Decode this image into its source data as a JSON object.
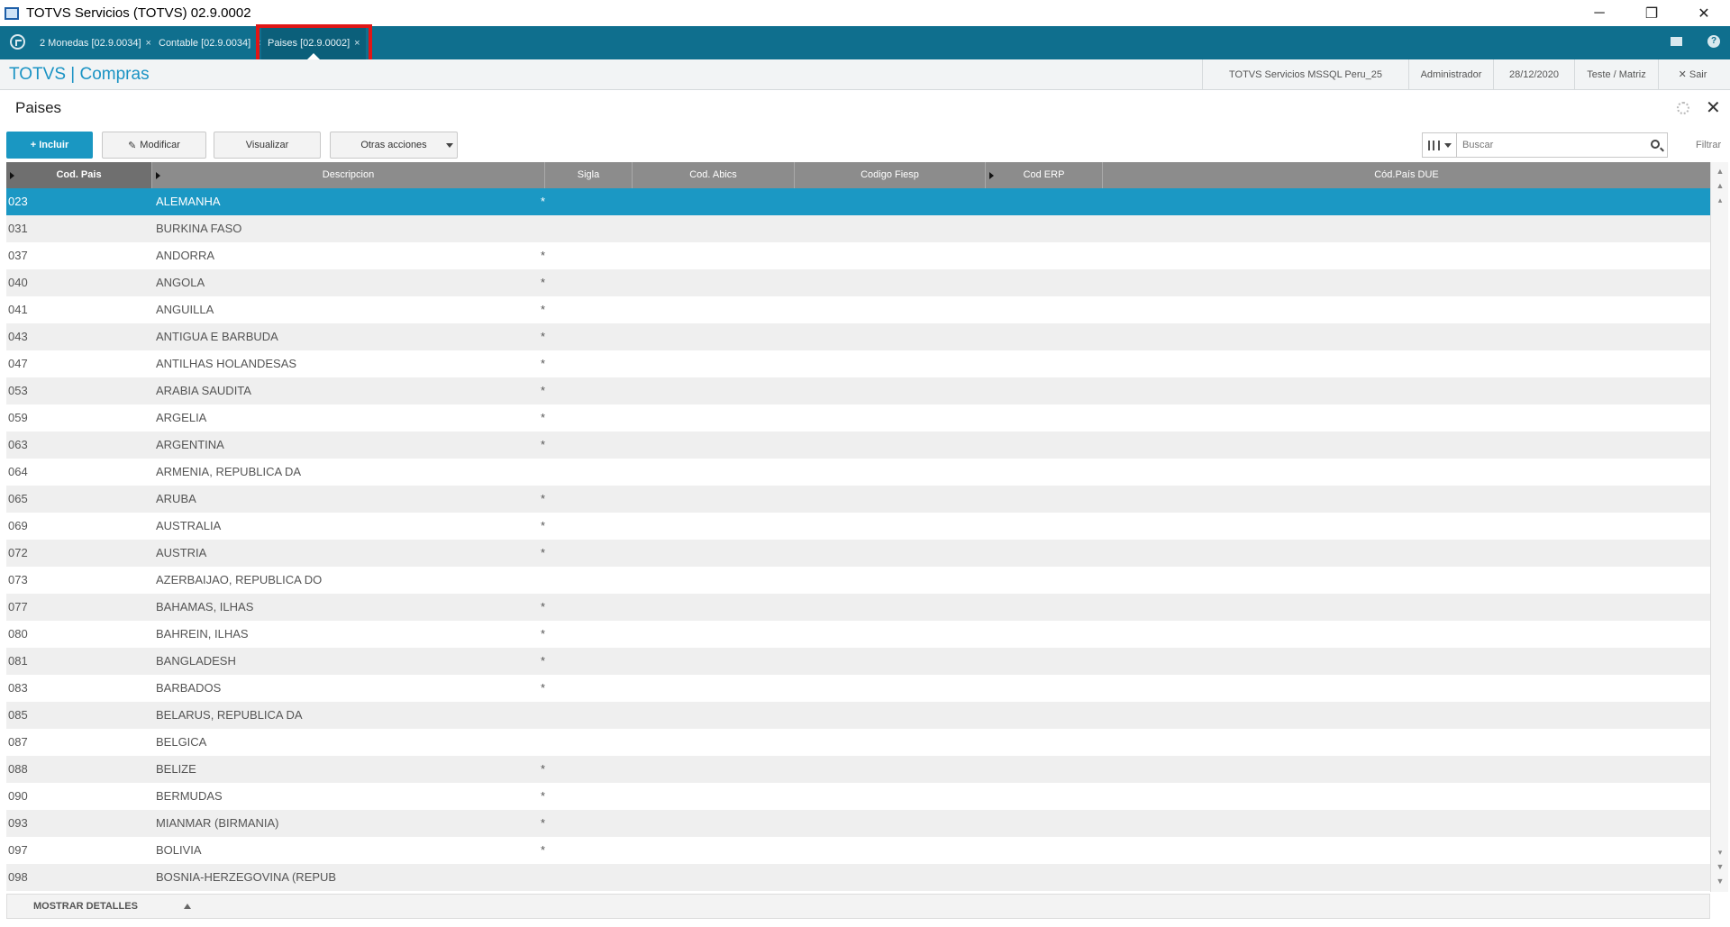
{
  "window": {
    "title": "TOTVS Servicios (TOTVS) 02.9.0002",
    "minimize": "─",
    "maximize": "❐",
    "close": "✕"
  },
  "tabs": [
    {
      "label": "2 Monedas [02.9.0034]",
      "close": "×"
    },
    {
      "label": "Contable [02.9.0034]",
      "close": "×"
    },
    {
      "label": "Paises [02.9.0002]",
      "close": "×"
    }
  ],
  "icons": {
    "home": "home-icon",
    "mail": "mail-icon",
    "help": "?"
  },
  "header": {
    "brand": "TOTVS | Compras",
    "company": "TOTVS Servicios MSSQL Peru_25",
    "user": "Administrador",
    "date": "28/12/2020",
    "branch": "Teste / Matriz",
    "exit": "✕  Sair"
  },
  "page": {
    "title": "Paises"
  },
  "toolbar": {
    "include": "+ Incluir",
    "modify": "Modificar",
    "view": "Visualizar",
    "other": "Otras acciones",
    "search_placeholder": "Buscar",
    "filter": "Filtrar"
  },
  "grid": {
    "columns": [
      "Cod. Pais",
      "Descripcion",
      "Sigla",
      "Cod. Abics",
      "Codigo Fiesp",
      "Cod ERP",
      "Cód.País DUE"
    ],
    "rows": [
      [
        "023",
        "ALEMANHA",
        "*"
      ],
      [
        "031",
        "BURKINA FASO",
        ""
      ],
      [
        "037",
        "ANDORRA",
        "*"
      ],
      [
        "040",
        "ANGOLA",
        "*"
      ],
      [
        "041",
        "ANGUILLA",
        "*"
      ],
      [
        "043",
        "ANTIGUA E BARBUDA",
        "*"
      ],
      [
        "047",
        "ANTILHAS HOLANDESAS",
        "*"
      ],
      [
        "053",
        "ARABIA SAUDITA",
        "*"
      ],
      [
        "059",
        "ARGELIA",
        "*"
      ],
      [
        "063",
        "ARGENTINA",
        "*"
      ],
      [
        "064",
        "ARMENIA, REPUBLICA DA",
        ""
      ],
      [
        "065",
        "ARUBA",
        "*"
      ],
      [
        "069",
        "AUSTRALIA",
        "*"
      ],
      [
        "072",
        "AUSTRIA",
        "*"
      ],
      [
        "073",
        "AZERBAIJAO, REPUBLICA DO",
        ""
      ],
      [
        "077",
        "BAHAMAS, ILHAS",
        "*"
      ],
      [
        "080",
        "BAHREIN, ILHAS",
        "*"
      ],
      [
        "081",
        "BANGLADESH",
        "*"
      ],
      [
        "083",
        "BARBADOS",
        "*"
      ],
      [
        "085",
        "BELARUS, REPUBLICA DA",
        ""
      ],
      [
        "087",
        "BELGICA",
        ""
      ],
      [
        "088",
        "BELIZE",
        "*"
      ],
      [
        "090",
        "BERMUDAS",
        "*"
      ],
      [
        "093",
        "MIANMAR (BIRMANIA)",
        "*"
      ],
      [
        "097",
        "BOLIVIA",
        "*"
      ],
      [
        "098",
        "BOSNIA-HERZEGOVINA (REPUB",
        ""
      ]
    ]
  },
  "footer": {
    "details": "MOSTRAR DETALLES"
  },
  "colors": {
    "accent": "#1b98c4",
    "tabbar": "#0f6f8e",
    "highlight": "#e01616"
  }
}
